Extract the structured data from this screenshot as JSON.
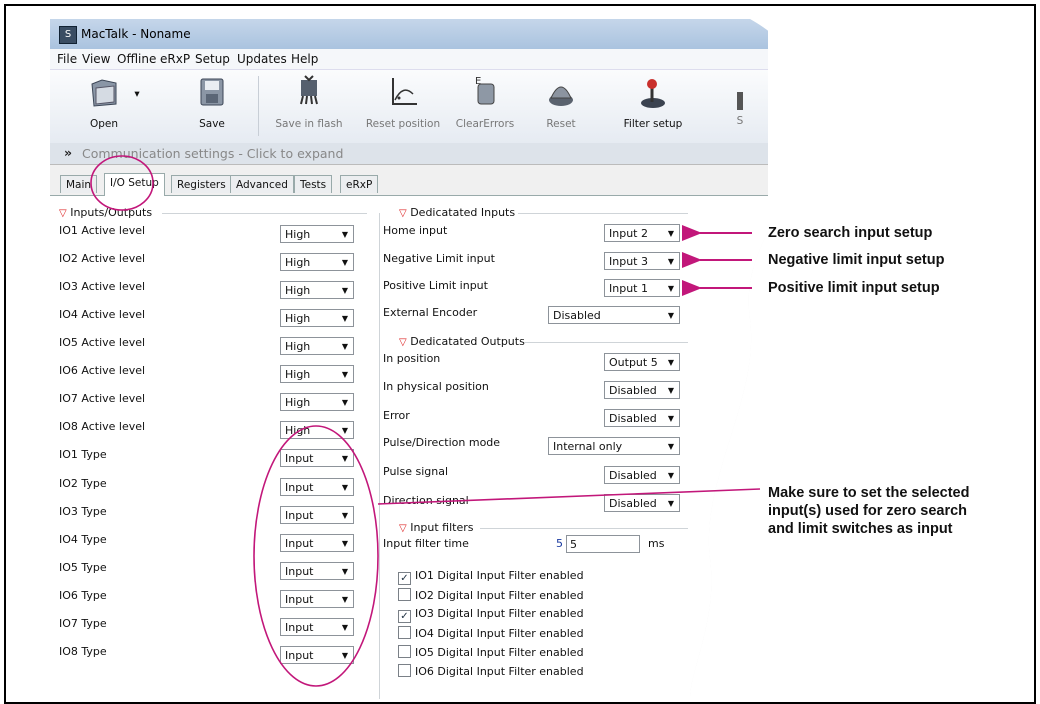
{
  "window": {
    "title": "MacTalk - Noname",
    "icon": "mactalk-app-icon"
  },
  "menu": [
    "File",
    "View",
    "Offline",
    "eRxP",
    "Setup",
    "Updates",
    "Help"
  ],
  "toolbar": {
    "open": "Open",
    "save": "Save",
    "save_in_flash": "Save in flash",
    "reset_position": "Reset position",
    "clear_errors": "ClearErrors",
    "reset": "Reset",
    "filter_setup": "Filter setup",
    "cut_off": "S"
  },
  "communication": {
    "expander": "»",
    "text": "Communication settings - Click to expand"
  },
  "tabs": [
    "Main",
    "I/O Setup",
    "Registers",
    "Advanced",
    "Tests",
    "eRxP"
  ],
  "inputs_outputs": {
    "heading": "Inputs/Outputs",
    "rows": [
      {
        "label": "IO1 Active level",
        "value": "High"
      },
      {
        "label": "IO2 Active level",
        "value": "High"
      },
      {
        "label": "IO3 Active level",
        "value": "High"
      },
      {
        "label": "IO4 Active level",
        "value": "High"
      },
      {
        "label": "IO5 Active level",
        "value": "High"
      },
      {
        "label": "IO6 Active level",
        "value": "High"
      },
      {
        "label": "IO7 Active level",
        "value": "High"
      },
      {
        "label": "IO8 Active level",
        "value": "High"
      },
      {
        "label": "IO1 Type",
        "value": "Input"
      },
      {
        "label": "IO2 Type",
        "value": "Input"
      },
      {
        "label": "IO3 Type",
        "value": "Input"
      },
      {
        "label": "IO4 Type",
        "value": "Input"
      },
      {
        "label": "IO5 Type",
        "value": "Input"
      },
      {
        "label": "IO6 Type",
        "value": "Input"
      },
      {
        "label": "IO7 Type",
        "value": "Input"
      },
      {
        "label": "IO8 Type",
        "value": "Input"
      }
    ]
  },
  "dedicated_inputs": {
    "heading": "Dedicatated Inputs",
    "home_input": {
      "label": "Home input",
      "value": "Input 2"
    },
    "negative_limit": {
      "label": "Negative Limit input",
      "value": "Input 3"
    },
    "positive_limit": {
      "label": "Positive Limit input",
      "value": "Input 1"
    },
    "external_encoder": {
      "label": "External Encoder",
      "value": "Disabled"
    }
  },
  "dedicated_outputs": {
    "heading": "Dedicatated Outputs",
    "in_position": {
      "label": "In position",
      "value": "Output 5"
    },
    "in_physical_position": {
      "label": "In physical position",
      "value": "Disabled"
    },
    "error": {
      "label": "Error",
      "value": "Disabled"
    },
    "pulse_direction_mode": {
      "label": "Pulse/Direction mode",
      "value": "Internal only"
    },
    "pulse_signal": {
      "label": "Pulse signal",
      "value": "Disabled"
    },
    "direction_signal": {
      "label": "Direction signal",
      "value": "Disabled"
    }
  },
  "input_filters": {
    "heading": "Input filters",
    "filter_time": {
      "label": "Input filter time",
      "current": "5",
      "value": "5",
      "unit": "ms"
    },
    "checkboxes": [
      {
        "label": "IO1 Digital Input Filter enabled",
        "checked": true
      },
      {
        "label": "IO2 Digital Input Filter enabled",
        "checked": false
      },
      {
        "label": "IO3 Digital Input Filter enabled",
        "checked": true
      },
      {
        "label": "IO4 Digital Input Filter enabled",
        "checked": false
      },
      {
        "label": "IO5 Digital Input Filter enabled",
        "checked": false
      },
      {
        "label": "IO6 Digital Input Filter enabled",
        "checked": false
      }
    ]
  },
  "annotations": {
    "zero_search": "Zero search input setup",
    "negative_limit": "Negative limit input setup",
    "positive_limit": "Positive limit input setup",
    "note_line1": "Make sure to set the selected",
    "note_line2": "input(s) used for zero search",
    "note_line3": "and limit switches as input"
  },
  "colors": {
    "annotation": "#c2177a",
    "section_triangle": "#d22222"
  }
}
